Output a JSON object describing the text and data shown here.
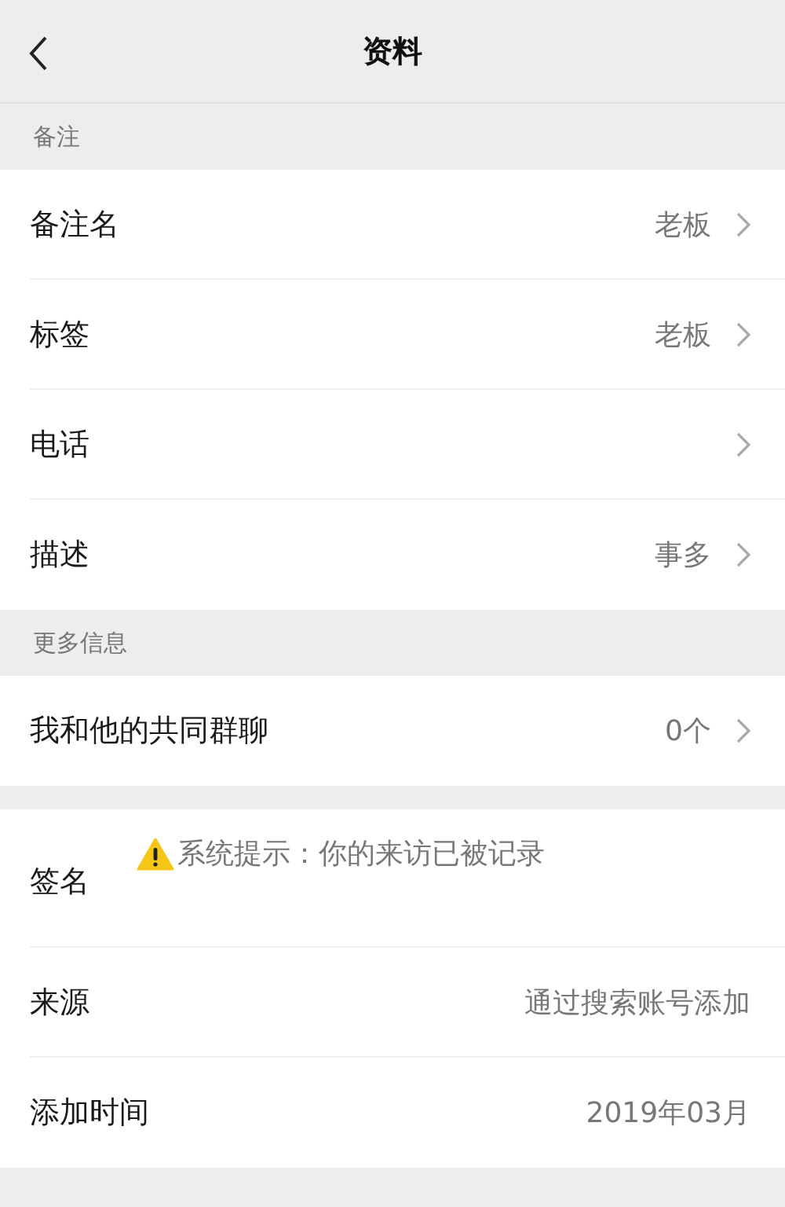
{
  "header": {
    "title": "资料"
  },
  "sections": [
    {
      "heading": "备注",
      "rows": [
        {
          "kind": "link",
          "label": "备注名",
          "value": "老板"
        },
        {
          "kind": "link",
          "label": "标签",
          "value": "老板"
        },
        {
          "kind": "link",
          "label": "电话"
        },
        {
          "kind": "link",
          "label": "描述",
          "value": "事多"
        }
      ]
    },
    {
      "heading": "更多信息",
      "rows": [
        {
          "kind": "link",
          "label": "我和他的共同群聊",
          "value": "0个"
        }
      ]
    },
    {
      "rows": [
        {
          "kind": "signature",
          "label": "签名",
          "value": "系统提示：你的来访已被记录"
        },
        {
          "kind": "info",
          "label": "来源",
          "value": "通过搜索账号添加"
        },
        {
          "kind": "info",
          "label": "添加时间",
          "value": "2019年03月"
        }
      ]
    }
  ]
}
